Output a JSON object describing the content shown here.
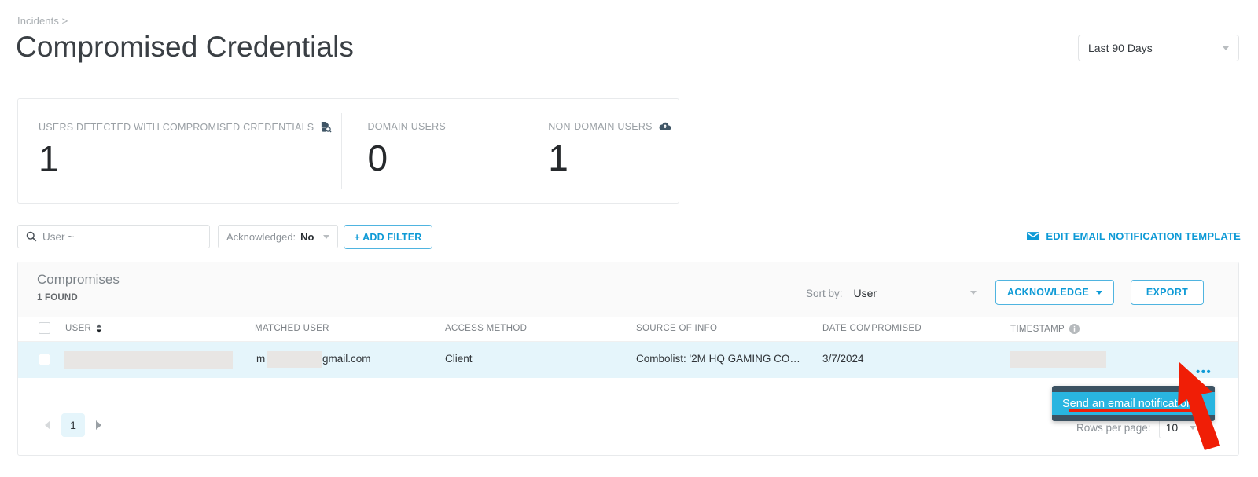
{
  "breadcrumb": "Incidents >",
  "page_title": "Compromised Credentials",
  "daterange": {
    "value": "Last 90 Days"
  },
  "stats": [
    {
      "label": "USERS DETECTED WITH COMPROMISED CREDENTIALS",
      "value": "1",
      "icon": "document-search-icon"
    },
    {
      "label": "DOMAIN USERS",
      "value": "0",
      "icon": ""
    },
    {
      "label": "NON-DOMAIN USERS",
      "value": "1",
      "icon": "cloud-upload-icon"
    }
  ],
  "filters": {
    "search_placeholder": "User ~",
    "acknowledged_label": "Acknowledged:",
    "acknowledged_value": "No",
    "add_filter_label": "+ ADD FILTER",
    "edit_template_label": "EDIT EMAIL NOTIFICATION TEMPLATE"
  },
  "table": {
    "title": "Compromises",
    "found": "1 FOUND",
    "sort_by_label": "Sort by:",
    "sort_by_value": "User",
    "acknowledge_label": "ACKNOWLEDGE",
    "export_label": "EXPORT",
    "columns": [
      "USER",
      "MATCHED USER",
      "ACCESS METHOD",
      "SOURCE OF INFO",
      "DATE COMPROMISED",
      "TIMESTAMP"
    ],
    "rows": [
      {
        "user": "",
        "matched_user_prefix": "m",
        "matched_user_suffix": "gmail.com",
        "access_method": "Client",
        "source_of_info": "Combolist: '2M HQ GAMING CO…",
        "date_compromised": "3/7/2024",
        "timestamp": ""
      }
    ]
  },
  "footer": {
    "page": "1",
    "rows_per_page_label": "Rows per page:",
    "rows_per_page_value": "10"
  },
  "context_menu": {
    "item": "Send an email notification"
  },
  "colors": {
    "accent_blue": "#0e9ad6",
    "row_highlight": "#e5f5fb",
    "menu_bg": "#3c5262",
    "menu_item": "#29b5e0",
    "annotation_red": "#f01e06"
  }
}
